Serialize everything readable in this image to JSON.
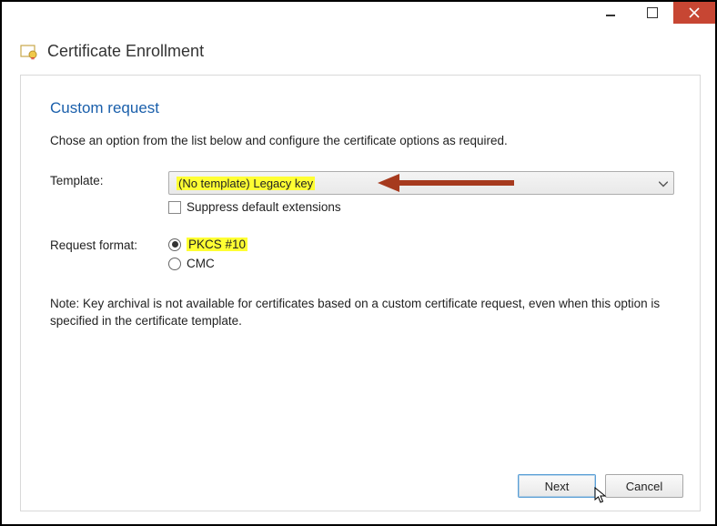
{
  "window": {
    "title": "Certificate Enrollment"
  },
  "section": {
    "heading": "Custom request",
    "instruction": "Chose an option from the list below and configure the certificate options as required."
  },
  "form": {
    "template_label": "Template:",
    "template_value": "(No template) Legacy key",
    "suppress_label": "Suppress default extensions",
    "suppress_checked": false,
    "format_label": "Request format:",
    "format_options": [
      {
        "label": "PKCS #10",
        "selected": true,
        "highlight": true
      },
      {
        "label": "CMC",
        "selected": false,
        "highlight": false
      }
    ]
  },
  "note": "Note: Key archival is not available for certificates based on a custom certificate request, even when this option is specified in the certificate template.",
  "buttons": {
    "next": "Next",
    "cancel": "Cancel"
  }
}
